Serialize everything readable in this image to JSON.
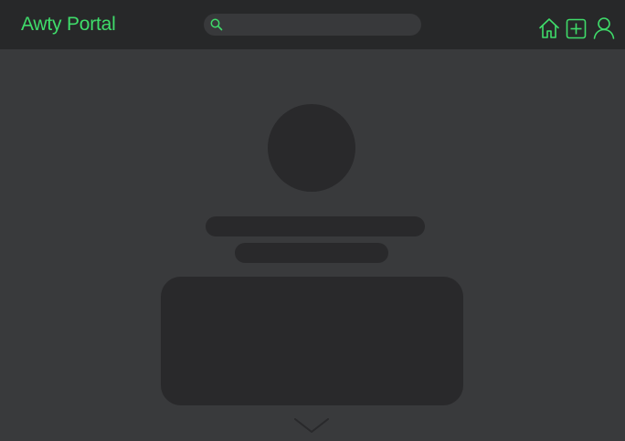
{
  "header": {
    "logo_text": "Awty Portal",
    "search": {
      "placeholder": "",
      "value": "",
      "icon": "search-icon"
    },
    "nav": [
      {
        "name": "home",
        "icon": "home-icon"
      },
      {
        "name": "add",
        "icon": "plus-square-icon"
      },
      {
        "name": "profile",
        "icon": "user-icon"
      }
    ]
  },
  "main": {
    "state": "loading-skeleton",
    "scroll_indicator_icon": "chevron-down-icon"
  },
  "colors": {
    "accent": "#3fdc6a",
    "topbar_bg": "#272829",
    "page_bg": "#393a3c",
    "skeleton": "#29292b",
    "search_bg": "#38393b"
  }
}
